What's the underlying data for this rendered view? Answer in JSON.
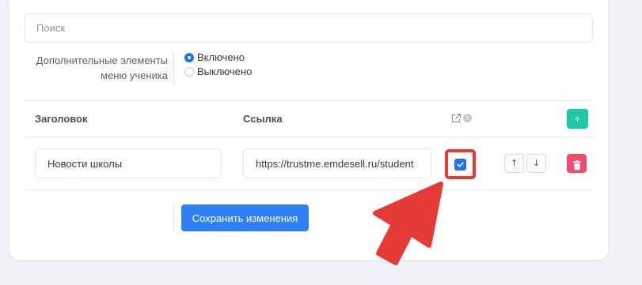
{
  "search": {
    "placeholder": "Поиск",
    "value": ""
  },
  "menu_setting": {
    "label_line1": "Дополнительные элементы",
    "label_line2": "меню ученика",
    "options": [
      {
        "label": "Включено",
        "checked": true
      },
      {
        "label": "Выключено",
        "checked": false
      }
    ]
  },
  "table": {
    "columns": {
      "title": "Заголовок",
      "link": "Ссылка",
      "external_icon": "external-link-icon",
      "info_icon": "info-icon"
    },
    "add_label": "+",
    "rows": [
      {
        "title": "Новости школы",
        "link": "https://trustme.emdesell.ru/student",
        "open_in_new_tab": true,
        "up_label": "↑",
        "down_label": "↓",
        "delete_icon": "trash-icon"
      }
    ]
  },
  "footer": {
    "save_label": "Сохранить изменения"
  },
  "annotation": {
    "arrow_icon": "red-pointer-arrow",
    "highlight_color": "#e53a36"
  },
  "colors": {
    "primary": "#2f80f7",
    "add": "#1ec9a6",
    "delete": "#ee4d6e",
    "annotation": "#e53a36"
  }
}
